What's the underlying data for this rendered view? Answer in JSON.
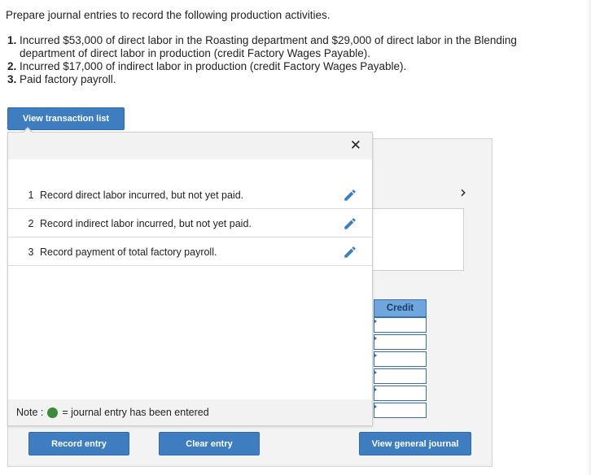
{
  "instructions": {
    "intro": "Prepare journal entries to record the following production activities.",
    "steps": [
      {
        "num": "1.",
        "text": "Incurred $53,000 of direct labor in the Roasting department and $29,000 of direct labor in the Blending department of direct labor in production (credit Factory Wages Payable)."
      },
      {
        "num": "2.",
        "text": "Incurred $17,000 of indirect labor in production (credit Factory Wages Payable)."
      },
      {
        "num": "3.",
        "text": "Paid factory payroll."
      }
    ]
  },
  "buttons": {
    "view_transaction_list": "View transaction list",
    "record_entry": "Record entry",
    "clear_entry": "Clear entry",
    "view_general_journal": "View general journal"
  },
  "popup": {
    "close_glyph": "✕",
    "transactions": [
      {
        "num": "1",
        "label": "Record direct labor incurred, but not yet paid."
      },
      {
        "num": "2",
        "label": "Record indirect labor incurred, but not yet paid."
      },
      {
        "num": "3",
        "label": "Record payment of total factory payroll."
      }
    ],
    "note_prefix": "Note :",
    "note_suffix": "= journal entry has been entered"
  },
  "journal": {
    "credit_header": "Credit",
    "next_glyph": "›"
  },
  "colors": {
    "button_blue": "#3e7dc0",
    "header_blue": "#6fa6de",
    "entered_green": "#3a8a3a",
    "edit_icon_blue": "#3e7dc0"
  },
  "icons": {
    "close": "close-icon",
    "edit": "pencil-icon",
    "next": "chevron-right-icon",
    "status": "green-dot-icon"
  }
}
